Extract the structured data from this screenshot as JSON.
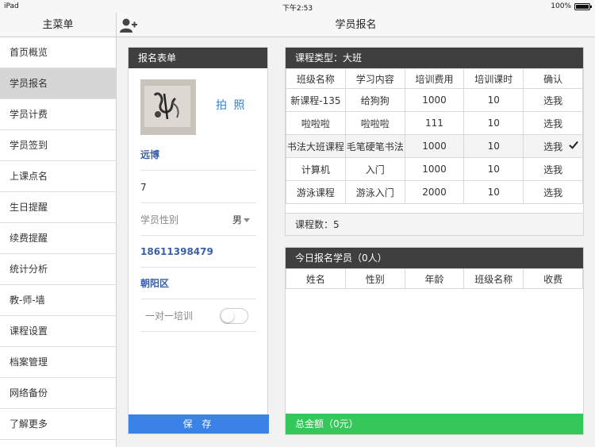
{
  "status": {
    "device": "iPad",
    "time": "下午2:53",
    "battery": "100%"
  },
  "sidebar": {
    "title": "主菜单",
    "items": [
      {
        "label": "首页概览"
      },
      {
        "label": "学员报名"
      },
      {
        "label": "学员计费"
      },
      {
        "label": "学员签到"
      },
      {
        "label": "上课点名"
      },
      {
        "label": "生日提醒"
      },
      {
        "label": "续费提醒"
      },
      {
        "label": "统计分析"
      },
      {
        "label": "教-师-墙"
      },
      {
        "label": "课程设置"
      },
      {
        "label": "档案管理"
      },
      {
        "label": "网络备份"
      },
      {
        "label": "了解更多"
      }
    ]
  },
  "topbar": {
    "title": "学员报名"
  },
  "form": {
    "header": "报名表单",
    "photo_button": "拍 照",
    "name": "远博",
    "age": "7",
    "gender_label": "学员性别",
    "gender_value": "男",
    "phone": "18611398479",
    "district": "朝阳区",
    "one_on_one_label": "一对一培训",
    "save_label": "保 存"
  },
  "courses": {
    "header": "课程类型：大班",
    "columns": [
      "班级名称",
      "学习内容",
      "培训费用",
      "培训课时",
      "确认"
    ],
    "rows": [
      {
        "name": "新课程-135",
        "content": "给狗狗",
        "fee": "1000",
        "hours": "10",
        "action": "选我"
      },
      {
        "name": "啦啦啦",
        "content": "啦啦啦",
        "fee": "111",
        "hours": "10",
        "action": "选我"
      },
      {
        "name": "书法大班课程",
        "content": "毛笔硬笔书法",
        "fee": "1000",
        "hours": "10",
        "action": "选我"
      },
      {
        "name": "计算机",
        "content": "入门",
        "fee": "1000",
        "hours": "10",
        "action": "选我"
      },
      {
        "name": "游泳课程",
        "content": "游泳入门",
        "fee": "2000",
        "hours": "10",
        "action": "选我"
      }
    ],
    "footer": "课程数：5"
  },
  "today": {
    "header": "今日报名学员（0人）",
    "columns": [
      "姓名",
      "性别",
      "年龄",
      "班级名称",
      "收费"
    ],
    "total": "总金额（0元）"
  },
  "colors": {
    "accent_blue": "#3b82e8",
    "success_green": "#35c759",
    "panel_header": "#3f3f3f"
  }
}
